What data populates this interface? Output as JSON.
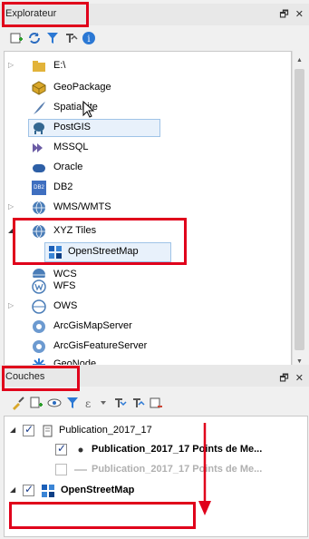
{
  "browser": {
    "title": "Explorateur",
    "controls": "🗗 ✕",
    "items": [
      {
        "label": "E:\\"
      },
      {
        "label": "GeoPackage"
      },
      {
        "label": "SpatiaLite"
      },
      {
        "label": "PostGIS"
      },
      {
        "label": "MSSQL"
      },
      {
        "label": "Oracle"
      },
      {
        "label": "DB2",
        "badge": "DB2"
      },
      {
        "label": "WMS/WMTS"
      },
      {
        "label": "XYZ Tiles"
      },
      {
        "label": "OpenStreetMap"
      },
      {
        "label": "WCS"
      },
      {
        "label": "WFS"
      },
      {
        "label": "OWS"
      },
      {
        "label": "ArcGisMapServer"
      },
      {
        "label": "ArcGisFeatureServer"
      },
      {
        "label": "GeoNode"
      }
    ]
  },
  "layers": {
    "title": "Couches",
    "controls": "🗗 ✕",
    "items": [
      {
        "label": "Publication_2017_17",
        "checked": true
      },
      {
        "label": "Publication_2017_17 Points de Me...",
        "checked": true
      },
      {
        "label": "Publication_2017_17 Points de Me...",
        "checked": false
      },
      {
        "label": "OpenStreetMap",
        "checked": true
      }
    ]
  },
  "colors": {
    "annotation": "#e0001b",
    "selection": "#e8f1fb"
  }
}
